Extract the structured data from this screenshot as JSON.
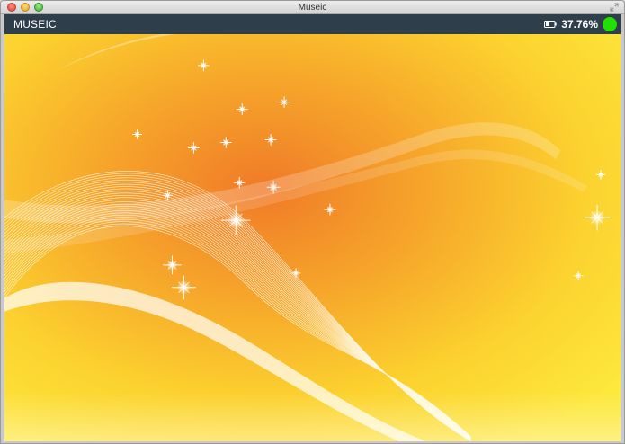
{
  "window": {
    "title": "Museic"
  },
  "appbar": {
    "title": "MUSEIC",
    "battery_percent": "37.76%",
    "status_color": "#22e000"
  },
  "icons": {
    "window_controls": [
      "close-icon",
      "minimize-icon",
      "zoom-icon"
    ],
    "fullscreen": "fullscreen-icon",
    "battery": "battery-icon"
  },
  "colors": {
    "appbar_bg": "#2f3e4b",
    "wallpaper_center": "#f08a2a",
    "wallpaper_edge": "#fde63a"
  }
}
